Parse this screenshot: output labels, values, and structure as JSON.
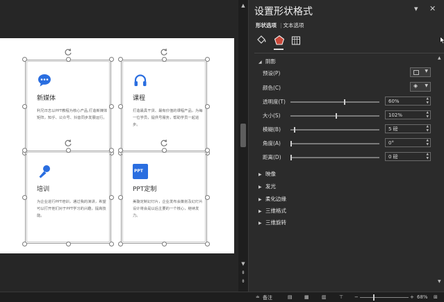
{
  "panel": {
    "title": "设置形状格式",
    "tabs": [
      "形状选项",
      "文本选项"
    ],
    "tab_separator": "|",
    "window_buttons": [
      "▾",
      "✕"
    ],
    "sections": {
      "shadow": {
        "label": "阴影",
        "preset_label": "预设(P)",
        "color_label": "颜色(C)",
        "transparency_label": "透明度(T)",
        "transparency_value": "60%",
        "size_label": "大小(S)",
        "size_value": "102%",
        "blur_label": "模糊(B)",
        "blur_value": "5 磅",
        "angle_label": "角度(A)",
        "angle_value": "0°",
        "distance_label": "距离(D)",
        "distance_value": "0 磅"
      },
      "collapsed": [
        "映像",
        "发光",
        "柔化边缘",
        "三维格式",
        "三维旋转"
      ]
    }
  },
  "slide": {
    "cards": [
      {
        "title": "新媒体",
        "desc": "利兄日志以PPT教程为核心产品,打造新媒体矩阵，知乎、公众号、抖音同步发展运行。"
      },
      {
        "title": "课程",
        "desc": "打造最具干货、最有价值的课程产品，为每一位学员，提供号服务，帮助学员一起进步。"
      },
      {
        "title": "培训",
        "desc": "为企业进行PPT培训，通过我的演讲，希望可以打开他们对于PPT学习的兴趣，提高技能。"
      },
      {
        "title": "PPT定制",
        "desc": "美璇定制幻灯片，企业发布会策划及幻灯片设计将会是以后主要的一个核心，继续发力。"
      }
    ],
    "icon_badge": "PPT"
  },
  "status": {
    "notes_label": "备注",
    "zoom": "68%"
  },
  "colors": {
    "accent_blue": "#2a6ee0",
    "accent_red": "#c9483a"
  }
}
